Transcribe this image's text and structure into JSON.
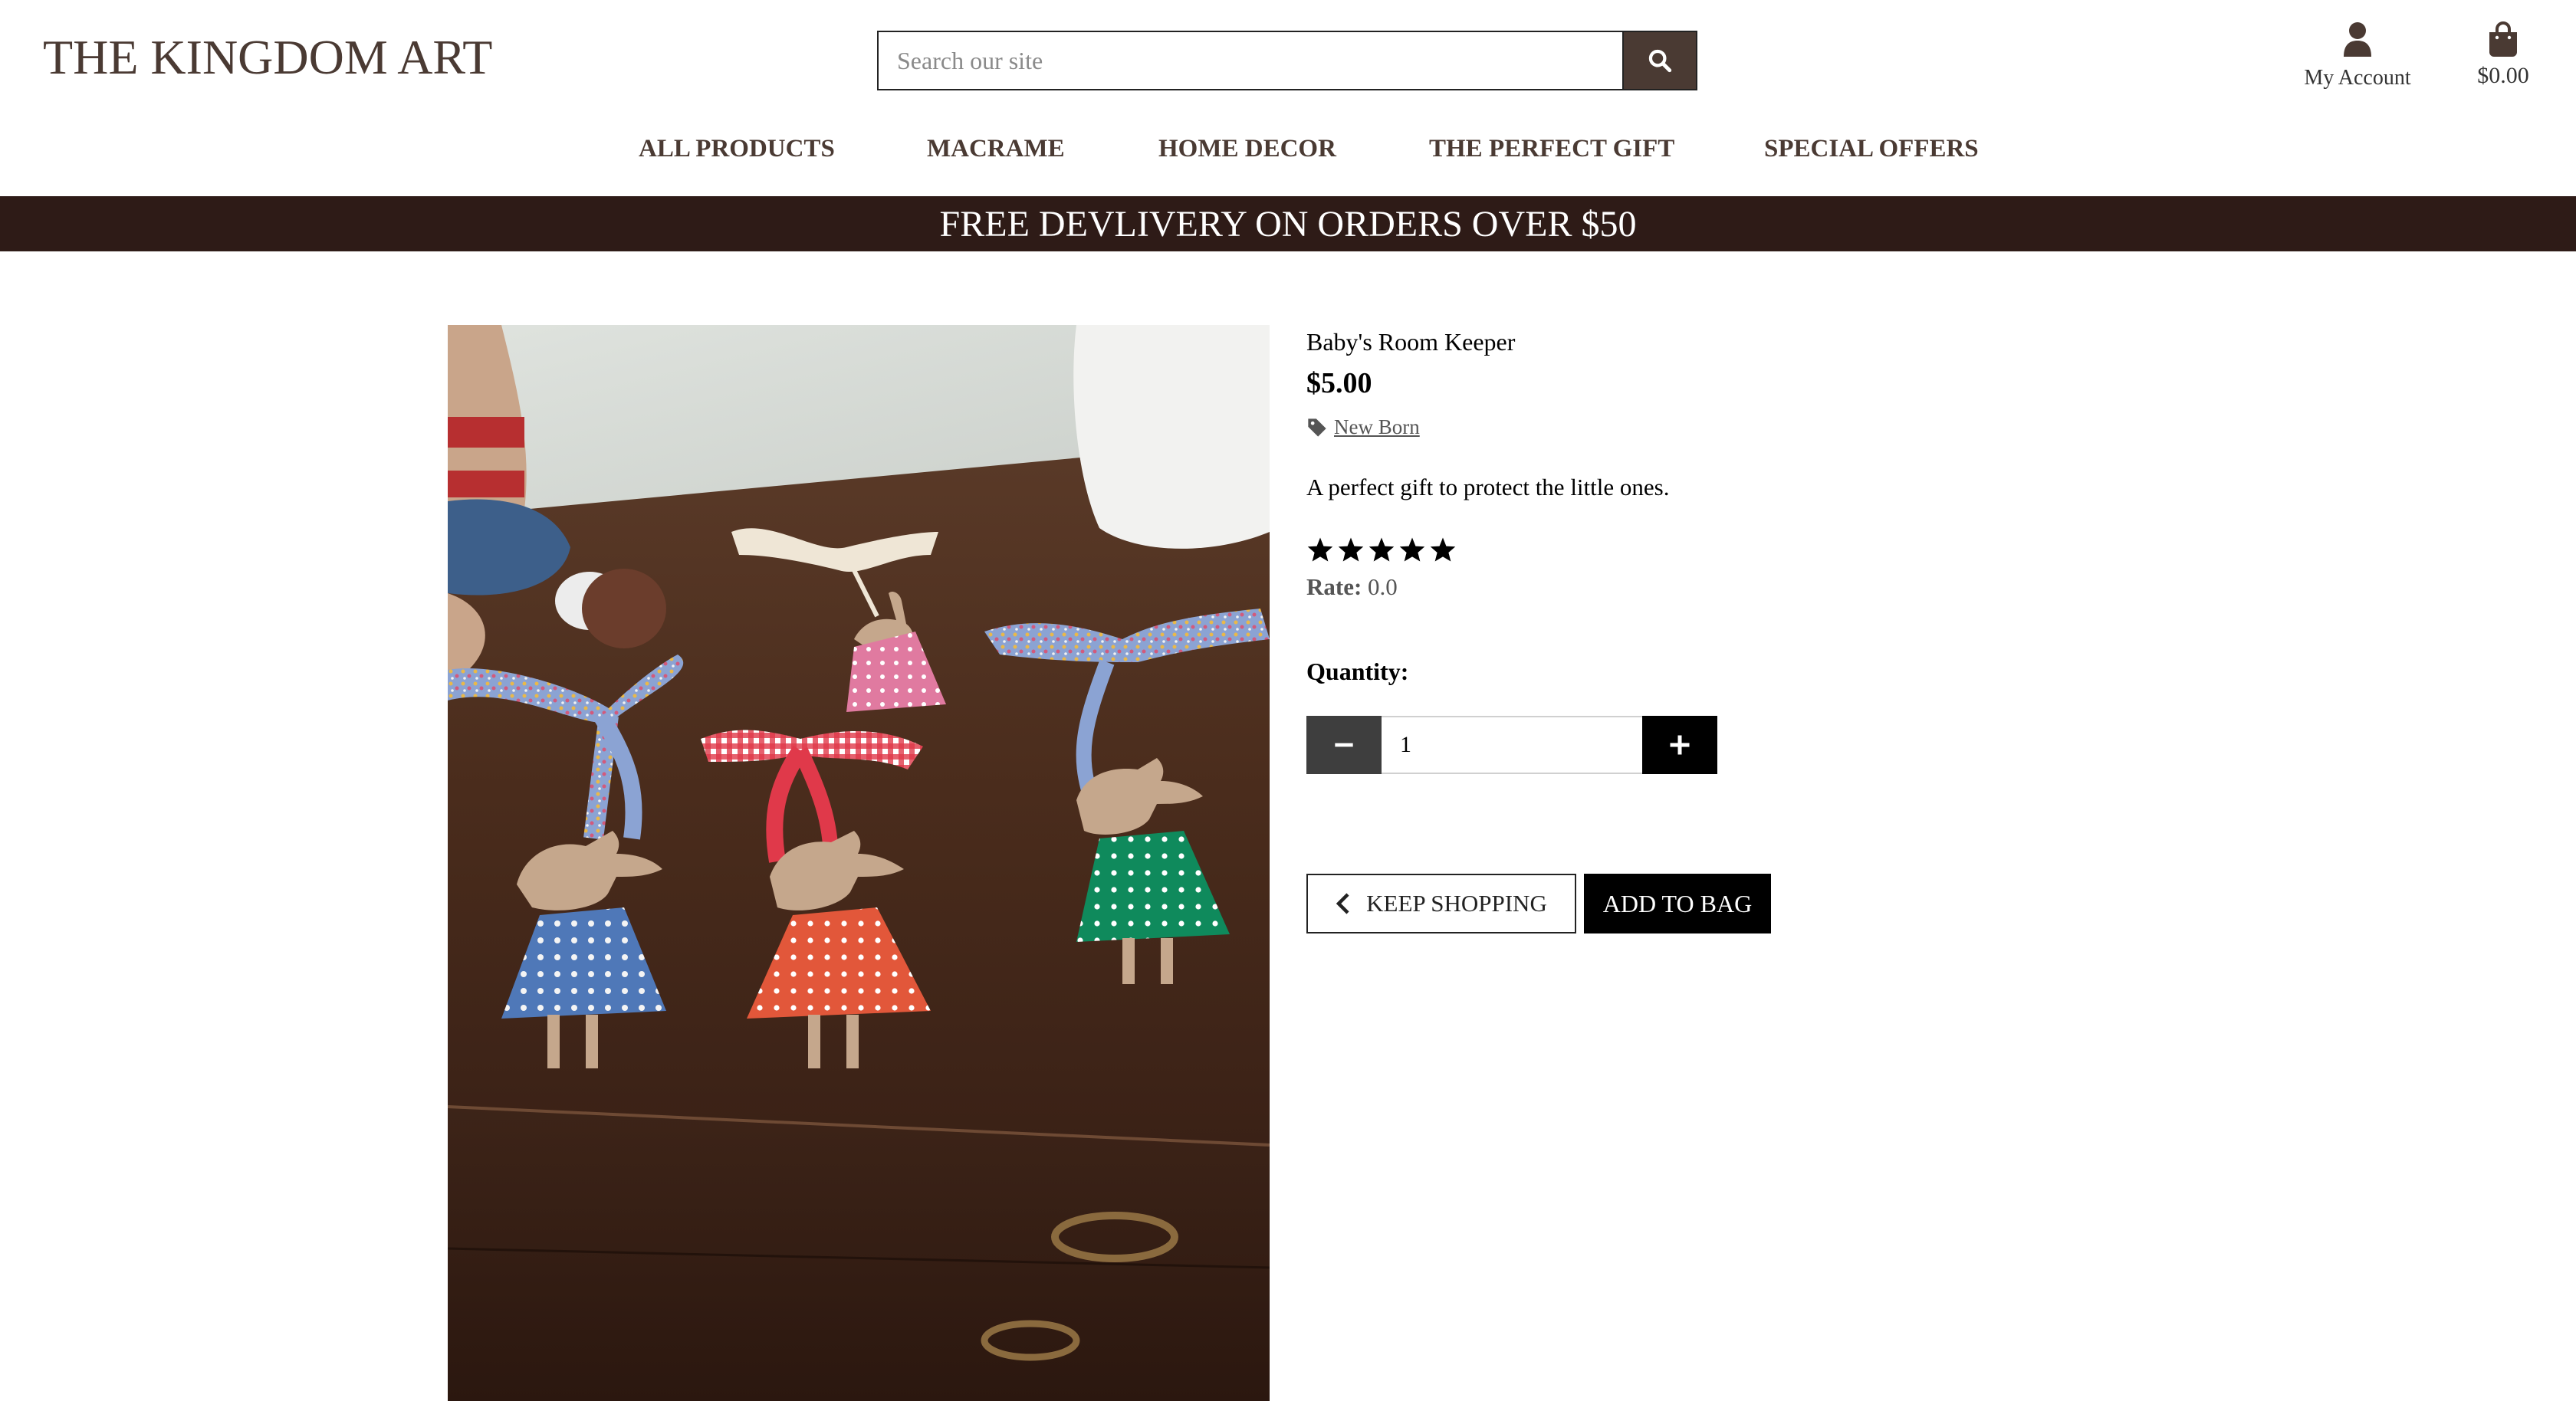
{
  "header": {
    "logo": "THE KINGDOM ART",
    "search": {
      "placeholder": "Search our site",
      "value": "",
      "button_icon": "search-icon"
    },
    "account": {
      "icon": "user-icon",
      "label": "My Account"
    },
    "bag": {
      "icon": "shopping-bag-icon",
      "total": "$0.00"
    }
  },
  "nav": {
    "items": [
      {
        "label": "ALL PRODUCTS"
      },
      {
        "label": "MACRAME"
      },
      {
        "label": "HOME DECOR"
      },
      {
        "label": "THE PERFECT GIFT"
      },
      {
        "label": "SPECIAL OFFERS"
      }
    ]
  },
  "banner": {
    "text": "FREE DEVLIVERY ON ORDERS OVER $50"
  },
  "product": {
    "name": "Baby's Room Keeper",
    "price": "$5.00",
    "category": {
      "icon": "tag-icon",
      "label": "New Born"
    },
    "description": "A perfect gift to protect the little ones.",
    "stars": {
      "count": 5,
      "icon": "star-icon"
    },
    "rate": {
      "label": "Rate:",
      "value": "0.0"
    },
    "quantity": {
      "label": "Quantity:",
      "value": "1",
      "decrement_icon": "minus-icon",
      "increment_icon": "plus-icon"
    },
    "buttons": {
      "keep_shopping": "KEEP SHOPPING",
      "keep_shopping_icon": "chevron-left-icon",
      "add_to_bag": "ADD TO BAG"
    }
  },
  "colors": {
    "brand": "#4a3a33",
    "banner_bg": "#2e1b17",
    "black": "#000000"
  }
}
